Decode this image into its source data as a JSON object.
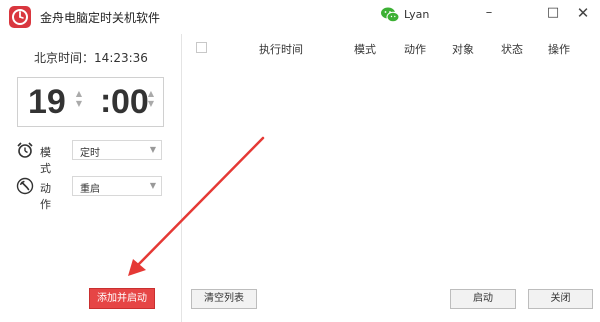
{
  "window": {
    "title": "金舟电脑定时关机软件",
    "user_name": "Lyan",
    "logo_icon": "power-logo-icon",
    "account_icon": "wechat-icon",
    "minimize_glyph": "–",
    "maximize_glyph": "□",
    "close_glyph": "✕"
  },
  "left_panel": {
    "clock_label": "北京时间：",
    "clock_value": "14:23:36",
    "time_picker": {
      "hour": "19",
      "separator": ":",
      "minute": "00"
    },
    "mode": {
      "label": "模式",
      "value": "定时",
      "icon": "alarm-clock-icon"
    },
    "action": {
      "label": "动作",
      "value": "重启",
      "icon": "wrench-icon"
    },
    "add_button": "添加并启动"
  },
  "task_table": {
    "columns": [
      "执行时间",
      "模式",
      "动作",
      "对象",
      "状态",
      "操作"
    ],
    "rows": []
  },
  "bottom_buttons": {
    "clear": "清空列表",
    "start": "启动",
    "close": "关闭"
  },
  "colors": {
    "brand_red": "#d9363e",
    "add_button_red": "#e64545",
    "annotation_arrow": "#e53935",
    "wechat_green": "#3cb034"
  }
}
